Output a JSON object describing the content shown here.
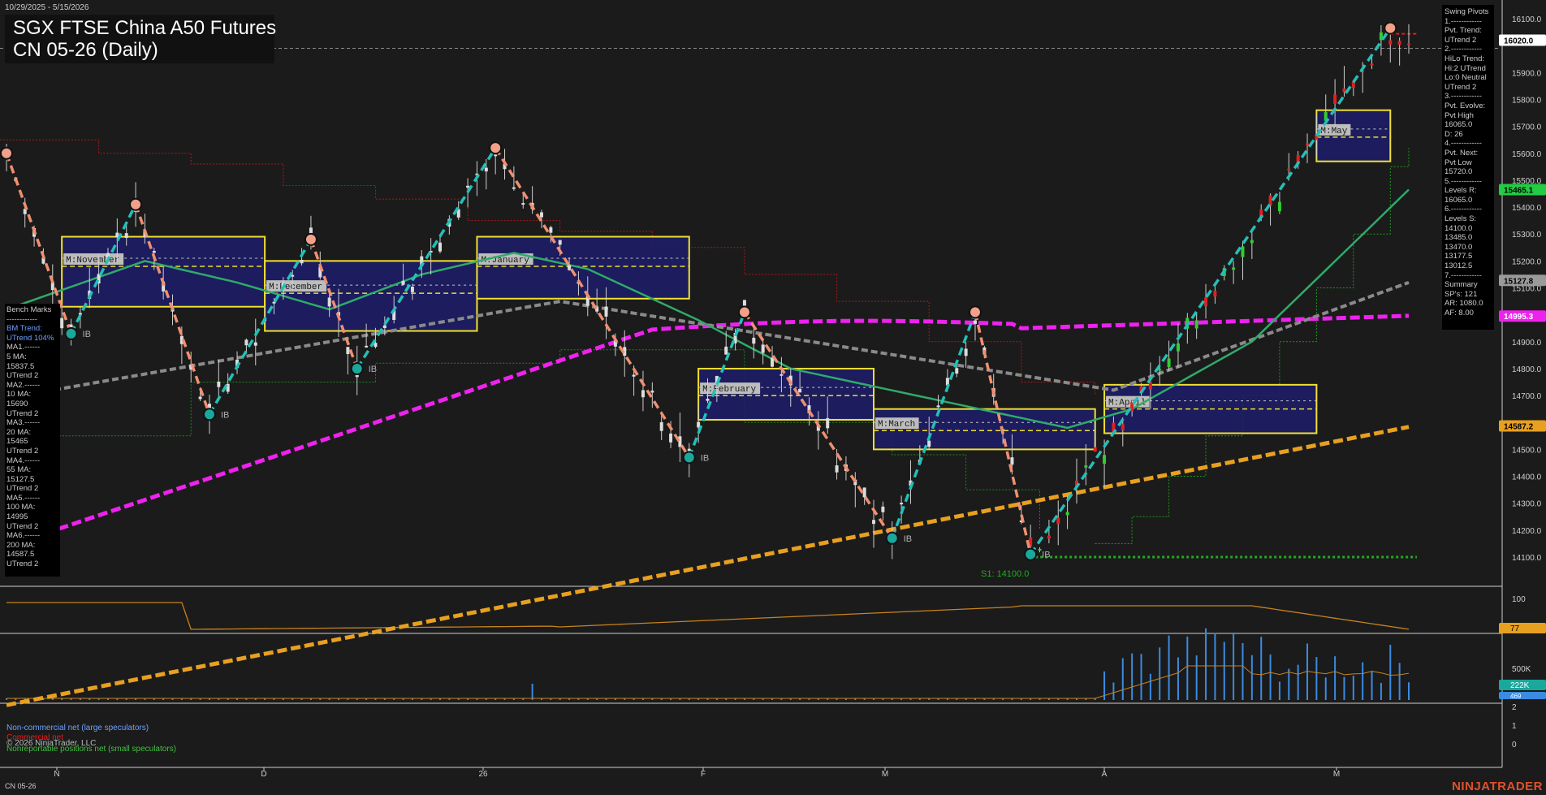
{
  "header": {
    "date_range": "10/29/2025 - 5/15/2026",
    "title_line1": "SGX FTSE China A50 Futures",
    "title_line2": "CN 05-26 (Daily)"
  },
  "footer": {
    "symbol": "CN 05-26",
    "brand": "NINJATRADER",
    "copyright": "© 2026 NinjaTrader, LLC"
  },
  "cot_legend": {
    "noncommercial": "Non-commercial net (large speculators)",
    "commercial": "Commercial net",
    "nonreportable": "Nonreportable positions net (small speculators)"
  },
  "bench_marks": {
    "lines": [
      "Bench Marks",
      "------------",
      "BM Trend:",
      "UTrend 104%",
      "MA1.------",
      "5 MA:",
      "15837.5",
      "UTrend 2",
      "MA2.------",
      "10 MA:",
      "15690",
      "UTrend 2",
      "MA3.------",
      "20 MA:",
      "15465",
      "UTrend 2",
      "MA4.------",
      "55 MA:",
      "15127.5",
      "UTrend 2",
      "MA5.------",
      "100 MA:",
      "14995",
      "UTrend 2",
      "MA6.------",
      "200 MA:",
      "14587.5",
      "UTrend 2"
    ]
  },
  "swing_pivots": {
    "lines": [
      "Swing Pivots",
      "1.------------",
      "Pvt. Trend:",
      "UTrend 2",
      "2.------------",
      "HiLo Trend:",
      "Hi:2 UTrend",
      "Lo:0 Neutral",
      "UTrend 2",
      "3.------------",
      "Pvt. Evolve:",
      "Pvt High",
      "16065.0",
      "D: 26",
      "4.------------",
      "Pvt. Next:",
      "Pvt Low",
      "15720.0",
      "5.------------",
      "Levels R:",
      "16065.0",
      "6.------------",
      "Levels S:",
      "14100.0",
      "13485.0",
      "13470.0",
      "13177.5",
      "13012.5",
      "7.------------",
      "Summary",
      "SP's: 121",
      "AR: 1080.0",
      "AF: 8.00"
    ]
  },
  "price_axis": {
    "ticks": [
      "16100.0",
      "15900.0",
      "15800.0",
      "15700.0",
      "15600.0",
      "15500.0",
      "15400.0",
      "15300.0",
      "15200.0",
      "15100.0",
      "14900.0",
      "14800.0",
      "14700.0",
      "14500.0",
      "14400.0",
      "14300.0",
      "14200.0",
      "14100.0"
    ],
    "tags": [
      {
        "label": "16020.0",
        "value": 16020,
        "bg": "#ffffff",
        "fg": "#000000"
      },
      {
        "label": "15465.1",
        "value": 15465,
        "bg": "#22cc44",
        "fg": "#000000"
      },
      {
        "label": "15127.8",
        "value": 15127.8,
        "bg": "#9a9a9a",
        "fg": "#000000"
      },
      {
        "label": "14995.3",
        "value": 14995.3,
        "bg": "#ee22ee",
        "fg": "#ffffff"
      },
      {
        "label": "14587.2",
        "value": 14587.2,
        "bg": "#e8a020",
        "fg": "#000000"
      }
    ]
  },
  "indicator_axes": {
    "osc_tick": "100",
    "osc_tag": "77",
    "vol_ticks": [
      "500K"
    ],
    "vol_tags": [
      "222K",
      "469"
    ],
    "cot_ticks": [
      "2",
      "1",
      "0"
    ]
  },
  "x_axis": {
    "ticks": [
      "N",
      "D",
      "26",
      "F",
      "M",
      "A",
      "M"
    ]
  },
  "support_label": "S1: 14100.0",
  "month_boxes": [
    "M:November",
    "M:December",
    "M:January",
    "M:February",
    "M:March",
    "M:April",
    "M:May"
  ],
  "ib_label": "IB",
  "chart_data": {
    "type": "candlestick",
    "x_start": "2025-10-29",
    "x_end": "2026-05-15",
    "ylim": [
      14000,
      16150
    ],
    "grid": false,
    "moving_averages": [
      {
        "name": "5 MA",
        "value": 15837.5,
        "color": "#2bd4c4"
      },
      {
        "name": "10 MA",
        "value": 15690,
        "color": "#888888"
      },
      {
        "name": "20 MA",
        "value": 15465,
        "color": "#2faa6a"
      },
      {
        "name": "55 MA",
        "value": 15127.5,
        "color": "#777777"
      },
      {
        "name": "100 MA",
        "value": 14995,
        "color": "#ee22ee"
      },
      {
        "name": "200 MA",
        "value": 14587.5,
        "color": "#e8a020"
      }
    ],
    "swing_pivots": [
      {
        "x": 0,
        "y": 15600,
        "kind": "high"
      },
      {
        "x": 7,
        "y": 14930,
        "kind": "low"
      },
      {
        "x": 14,
        "y": 15410,
        "kind": "high"
      },
      {
        "x": 22,
        "y": 14630,
        "kind": "low"
      },
      {
        "x": 33,
        "y": 15280,
        "kind": "high"
      },
      {
        "x": 38,
        "y": 14800,
        "kind": "low"
      },
      {
        "x": 53,
        "y": 15620,
        "kind": "high"
      },
      {
        "x": 74,
        "y": 14470,
        "kind": "low"
      },
      {
        "x": 80,
        "y": 15010,
        "kind": "high"
      },
      {
        "x": 96,
        "y": 14170,
        "kind": "low"
      },
      {
        "x": 105,
        "y": 15010,
        "kind": "high"
      },
      {
        "x": 111,
        "y": 14110,
        "kind": "low"
      },
      {
        "x": 150,
        "y": 16065,
        "kind": "high"
      }
    ],
    "month_value_areas": [
      {
        "name": "M:November",
        "x0": 6,
        "x1": 27,
        "high": 15290,
        "low": 15030,
        "mid": 15180
      },
      {
        "name": "M:December",
        "x0": 28,
        "x1": 50,
        "high": 15200,
        "low": 14940,
        "mid": 15080
      },
      {
        "name": "M:January",
        "x0": 51,
        "x1": 73,
        "high": 15290,
        "low": 15060,
        "mid": 15180
      },
      {
        "name": "M:February",
        "x0": 75,
        "x1": 93,
        "high": 14800,
        "low": 14610,
        "mid": 14700
      },
      {
        "name": "M:March",
        "x0": 94,
        "x1": 117,
        "high": 14650,
        "low": 14500,
        "mid": 14570
      },
      {
        "name": "M:April",
        "x0": 119,
        "x1": 141,
        "high": 14740,
        "low": 14560,
        "mid": 14650
      },
      {
        "name": "M:May",
        "x0": 142,
        "x1": 149,
        "high": 15760,
        "low": 15570,
        "mid": 15660
      }
    ],
    "support_level": 14100,
    "resistance_level": 16065,
    "last_price": 16020
  }
}
